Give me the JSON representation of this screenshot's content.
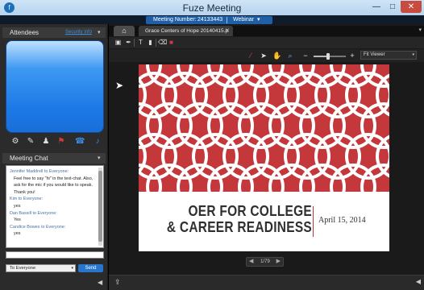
{
  "window": {
    "title": "Fuze Meeting",
    "logo": "f"
  },
  "window_controls": {
    "minimize": "—",
    "maximize": "□",
    "close": "✕"
  },
  "meeting_bar": {
    "label": "Meeting Number:",
    "number": "24133443",
    "mode": "Webinar",
    "caret": "▾"
  },
  "attendees": {
    "title": "Attendees",
    "link": "Security info",
    "caret": "▾"
  },
  "video_tools": [
    {
      "name": "gear-icon",
      "glyph": "⚙"
    },
    {
      "name": "pin-icon",
      "glyph": "✎"
    },
    {
      "name": "person-icon",
      "glyph": "♟"
    },
    {
      "name": "flag-icon",
      "glyph": "⚑"
    },
    {
      "name": "phone-icon",
      "glyph": "☎"
    },
    {
      "name": "mic-icon",
      "glyph": "♪"
    }
  ],
  "chat": {
    "title": "Meeting Chat",
    "caret": "▾",
    "messages": [
      {
        "sender": "Jennifer Maddrell to Everyone:",
        "text": "Feel free to say \"hi\" in the text-chat. Also, ask for the mic if you would like to speak. Thank you!"
      },
      {
        "sender": "Kim to Everyone:",
        "text": "yes"
      },
      {
        "sender": "Dan Bassill to Everyone:",
        "text": "Yes"
      },
      {
        "sender": "Candice Bowes to Everyone:",
        "text": "yes"
      }
    ],
    "input_value": "",
    "to_select": "To Everyone",
    "to_caret": "▾",
    "send": "Send"
  },
  "tabs": {
    "home": "⌂",
    "document": "Grace Centers of Hope 20140415.p",
    "close": "✕",
    "menu_caret": "▾"
  },
  "annotation_tools": [
    {
      "name": "select-box-icon",
      "glyph": "▣"
    },
    {
      "name": "pen-icon",
      "glyph": "✒"
    },
    {
      "name": "text-tool-icon",
      "glyph": "T"
    },
    {
      "name": "highlighter-icon",
      "glyph": "▮"
    },
    {
      "name": "eraser-icon",
      "glyph": "⌫"
    },
    {
      "name": "color-picker-icon",
      "glyph": "■"
    }
  ],
  "viewer_tools": [
    {
      "name": "laser-pointer-icon",
      "glyph": "⁄"
    },
    {
      "name": "arrow-pointer-icon",
      "glyph": "➤"
    },
    {
      "name": "hand-pan-icon",
      "glyph": "✋"
    },
    {
      "name": "zoom-icon",
      "glyph": "⌕"
    }
  ],
  "zoom": {
    "minus": "−",
    "plus": "+",
    "level": 0.45
  },
  "view_select": {
    "value": "Fit Viewer",
    "caret": "▾"
  },
  "slide": {
    "title_line1": "OER FOR COLLEGE",
    "title_line2": "& CAREER READINESS",
    "date": "April 15, 2014",
    "pattern_color": "#c4383c",
    "accent": "#b03a3a"
  },
  "pager": {
    "prev": "◀",
    "text": "1/79",
    "next": "▶"
  },
  "bottom": {
    "share": "⇪",
    "collapse_left": "◀",
    "collapse_right": "◀"
  }
}
